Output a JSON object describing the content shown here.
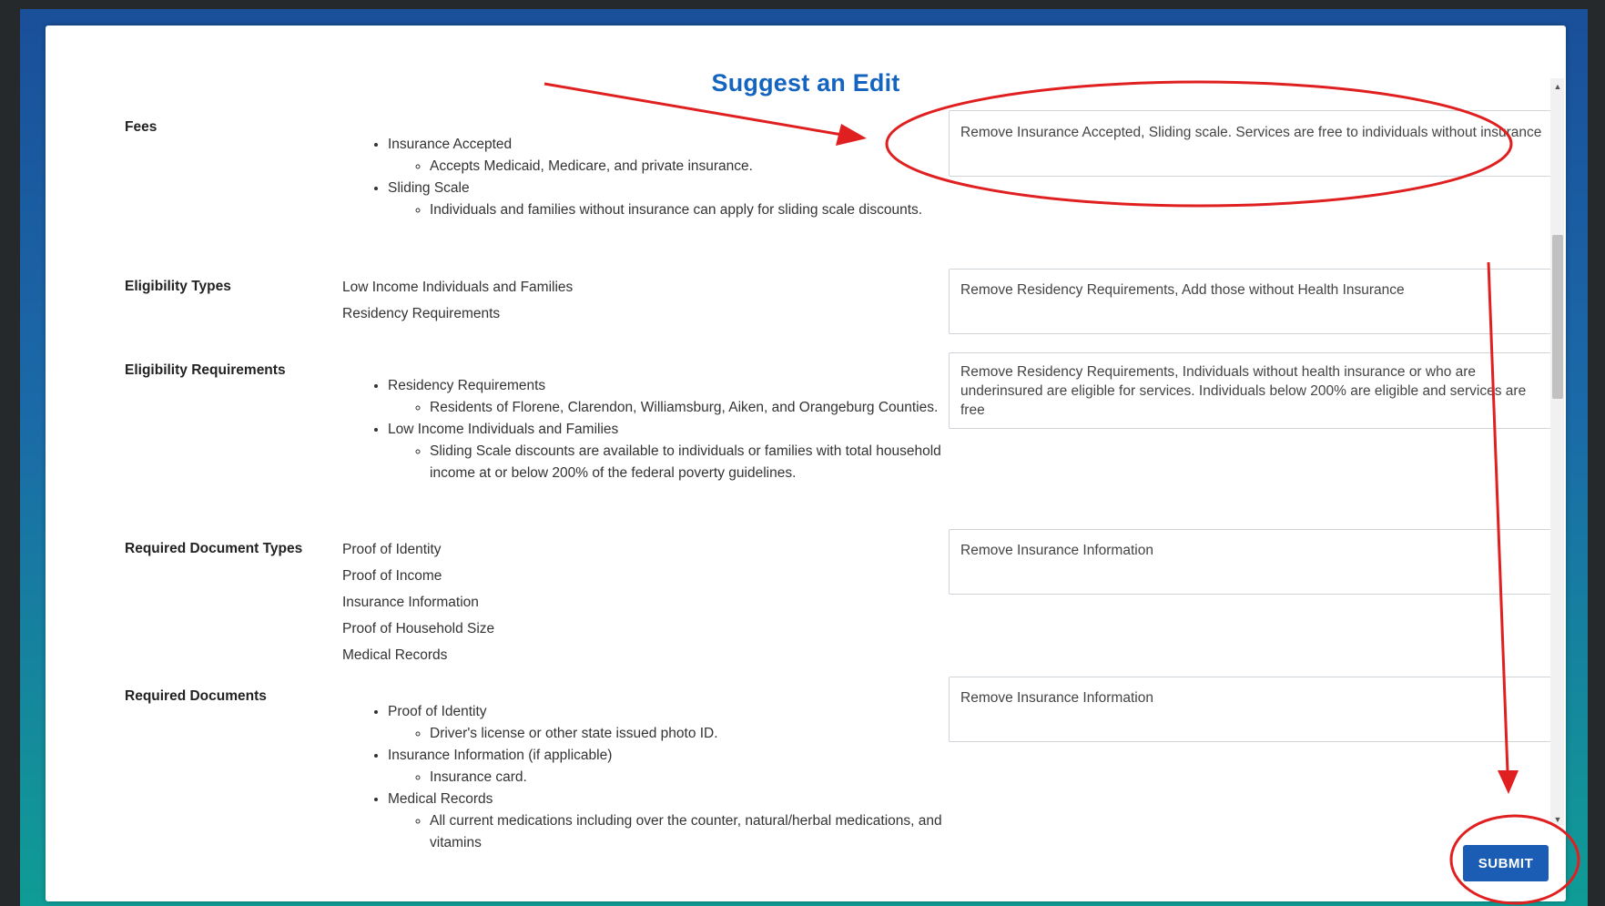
{
  "dialog": {
    "title": "Suggest an Edit",
    "submit_label": "SUBMIT"
  },
  "fields": {
    "fees": {
      "label": "Fees",
      "items": [
        {
          "text": "Insurance Accepted",
          "sub": [
            "Accepts Medicaid, Medicare, and private insurance."
          ]
        },
        {
          "text": "Sliding Scale",
          "sub": [
            "Individuals and families without insurance can apply for sliding scale discounts."
          ]
        }
      ],
      "suggestion": "Remove Insurance Accepted, Sliding scale. Services are free to individuals without insurance"
    },
    "eligibility_types": {
      "label": "Eligibility Types",
      "values": [
        "Low Income Individuals and Families",
        "Residency Requirements"
      ],
      "suggestion": "Remove Residency Requirements, Add those without Health Insurance"
    },
    "eligibility_requirements": {
      "label": "Eligibility Requirements",
      "items": [
        {
          "text": "Residency Requirements",
          "sub": [
            "Residents of Florene, Clarendon, Williamsburg, Aiken, and Orangeburg Counties."
          ]
        },
        {
          "text": "Low Income Individuals and Families",
          "sub": [
            "Sliding Scale discounts are available to individuals or families with total household income at or below 200% of the federal poverty guidelines."
          ]
        }
      ],
      "suggestion": "Remove Residency Requirements, Individuals without health insurance or who are underinsured are eligible for services. Individuals below 200% are eligible and services are free"
    },
    "required_document_types": {
      "label": "Required Document Types",
      "values": [
        "Proof of Identity",
        "Proof of Income",
        "Insurance Information",
        "Proof of Household Size",
        "Medical Records"
      ],
      "suggestion": "Remove Insurance Information"
    },
    "required_documents": {
      "label": "Required Documents",
      "items": [
        {
          "text": "Proof of Identity",
          "sub": [
            "Driver's license or other state issued photo ID."
          ]
        },
        {
          "text": "Insurance Information (if applicable)",
          "sub": [
            "Insurance card."
          ]
        },
        {
          "text": "Medical Records",
          "sub": [
            "All current medications including over the counter, natural/herbal medications, and vitamins"
          ]
        }
      ],
      "suggestion": "Remove Insurance Information"
    }
  },
  "colors": {
    "title": "#1565c0",
    "submit_button": "#1b5db5",
    "annotation": "#e02020",
    "background_gradient": [
      "#1a4f9a",
      "#0f9c96"
    ]
  },
  "icons": {
    "scroll_up": "triangle-up",
    "scroll_down": "triangle-down"
  }
}
